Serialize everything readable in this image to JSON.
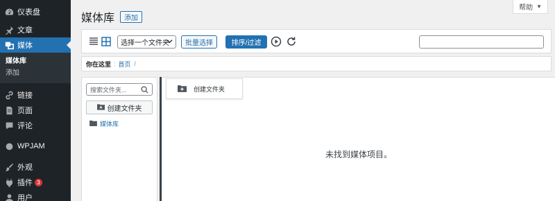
{
  "sidebar": {
    "items": [
      {
        "label": "仪表盘",
        "icon": "dashboard-icon"
      },
      {
        "label": "文章",
        "icon": "pin-icon"
      },
      {
        "label": "媒体",
        "icon": "media-icon",
        "active": true
      },
      {
        "label": "链接",
        "icon": "link-icon"
      },
      {
        "label": "页面",
        "icon": "page-icon"
      },
      {
        "label": "评论",
        "icon": "comment-icon"
      },
      {
        "label": "WPJAM",
        "icon": "wpjam-icon"
      },
      {
        "label": "外观",
        "icon": "brush-icon"
      },
      {
        "label": "插件",
        "icon": "plugin-icon",
        "badge": "3"
      },
      {
        "label": "用户",
        "icon": "user-icon"
      }
    ],
    "submenu": [
      {
        "label": "媒体库",
        "current": true
      },
      {
        "label": "添加"
      }
    ]
  },
  "help": {
    "label": "帮助",
    "arrow": "▼"
  },
  "header": {
    "title": "媒体库",
    "add_label": "添加"
  },
  "toolbar": {
    "folder_select": "选择一个文件夹",
    "bulk_label": "批量选择",
    "sort_label": "排序/过滤",
    "search_value": ""
  },
  "breadcrumb": {
    "prefix": "你在这里",
    "colon": ":",
    "home": "首页",
    "sep": "/"
  },
  "folder_panel": {
    "search_placeholder": "搜索文件夹...",
    "create_label": "创建文件夹",
    "folders": [
      {
        "label": "媒体库"
      }
    ]
  },
  "content": {
    "new_folder_label": "创建文件夹",
    "empty_message": "未找到媒体项目。"
  },
  "colors": {
    "accent": "#2271b1",
    "sidebar_bg": "#1d2327",
    "badge": "#d63638"
  }
}
